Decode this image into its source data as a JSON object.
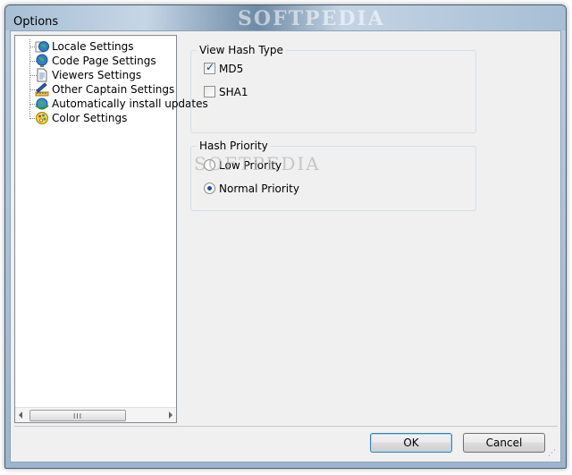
{
  "window": {
    "title": "Options",
    "watermark": "SOFTPEDIA"
  },
  "tree": {
    "items": [
      {
        "label": "Locale Settings",
        "icon": "globe-icon"
      },
      {
        "label": "Code Page Settings",
        "icon": "globe-icon"
      },
      {
        "label": "Viewers Settings",
        "icon": "document-icon"
      },
      {
        "label": "Other Captain Settings",
        "icon": "pencil-ruler-icon"
      },
      {
        "label": "Automatically install updates",
        "icon": "update-globe-icon"
      },
      {
        "label": "Color Settings",
        "icon": "color-palette-icon"
      }
    ],
    "scroll_grip": "III"
  },
  "hash_type": {
    "title": "View Hash Type",
    "options": [
      {
        "label": "MD5",
        "checked": true
      },
      {
        "label": "SHA1",
        "checked": false
      }
    ]
  },
  "hash_priority": {
    "title": "Hash Priority",
    "options": [
      {
        "label": "Low Priority",
        "selected": false
      },
      {
        "label": "Normal Priority",
        "selected": true
      }
    ]
  },
  "buttons": {
    "ok_label": "OK",
    "cancel_label": "Cancel"
  },
  "colors": {
    "accent": "#3c7fb1",
    "radio_dot": "#1f4ea0"
  }
}
